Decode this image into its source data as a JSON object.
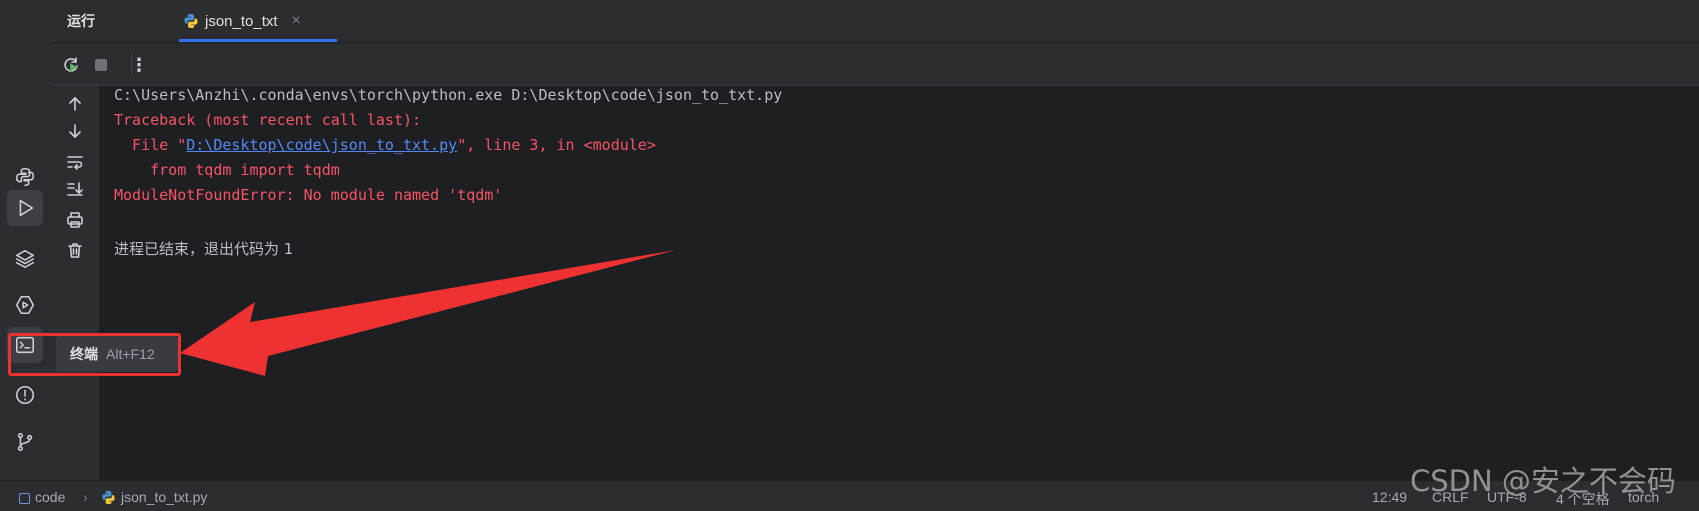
{
  "tool_window": {
    "title": "运行",
    "tab_label": "json_to_txt",
    "tab_close": "×"
  },
  "toolbar": {
    "more_glyph": "⋮"
  },
  "console": {
    "command_line": "C:\\Users\\Anzhi\\.conda\\envs\\torch\\python.exe D:\\Desktop\\code\\json_to_txt.py",
    "traceback_header": "Traceback (most recent call last):",
    "file_prefix": "  File \"",
    "file_link": "D:\\Desktop\\code\\json_to_txt.py",
    "file_suffix": "\", line 3, in <module>",
    "import_line": "    from tqdm import tqdm",
    "error_line": "ModuleNotFoundError: No module named 'tqdm'",
    "exit_message": "进程已结束，退出代码为 1"
  },
  "tooltip": {
    "label": "终端",
    "shortcut": "Alt+F12"
  },
  "statusbar": {
    "project": "code",
    "file": "json_to_txt.py",
    "position": "12:49",
    "line_ending": "CRLF",
    "encoding": "UTF-8",
    "indent": "4 个空格",
    "interpreter": "torch"
  },
  "watermark": "CSDN @安之不会码",
  "colors": {
    "background": "#1e1f22",
    "panel": "#2b2d30",
    "error": "#f75464",
    "link": "#548af7",
    "accent": "#3574f0",
    "annotation": "#e8332f"
  }
}
